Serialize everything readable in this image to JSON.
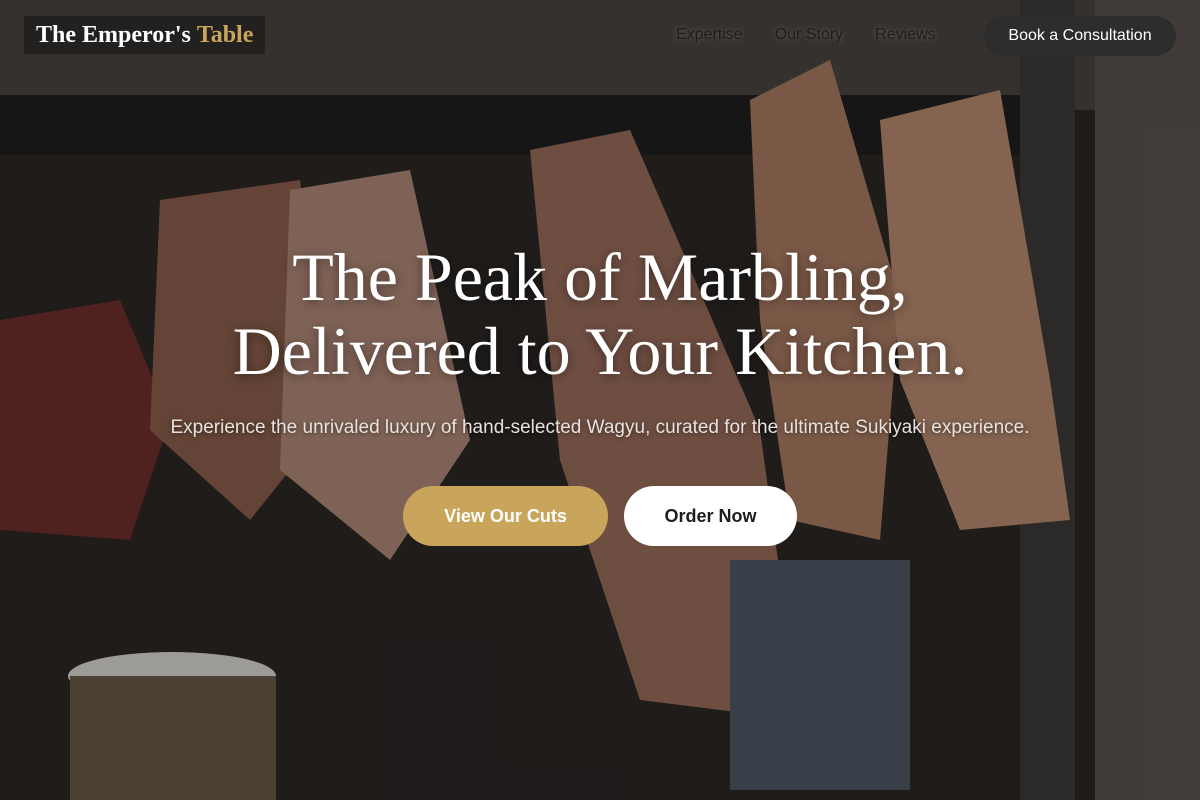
{
  "brand": {
    "name_main": "The Emperor's",
    "name_accent": "Table"
  },
  "nav": {
    "links": [
      "Expertise",
      "Our Story",
      "Reviews"
    ],
    "cta": "Book a Consultation"
  },
  "hero": {
    "headline_line1": "The Peak of Marbling,",
    "headline_line2": "Delivered to Your Kitchen.",
    "subtitle": "Experience the unrivaled luxury of hand-selected Wagyu, curated for the ultimate Sukiyaki experience.",
    "primary_cta": "View Our Cuts",
    "secondary_cta": "Order Now"
  },
  "colors": {
    "gold": "#c9a55b",
    "dark_button": "#2d2d2d",
    "white": "#ffffff"
  },
  "background_image": "meat-aging-room-photo"
}
